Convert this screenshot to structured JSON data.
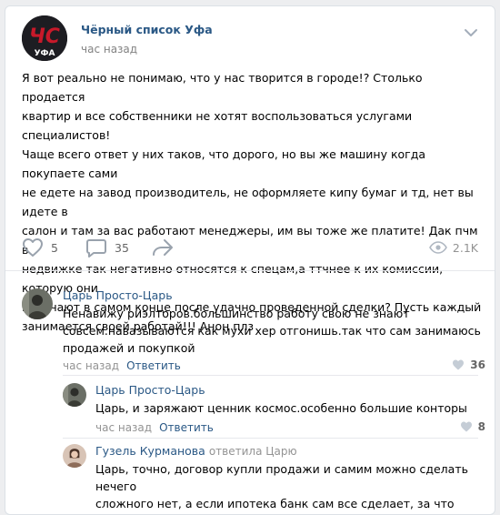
{
  "post": {
    "group_name": "Чёрный список Уфа",
    "time": "час назад",
    "logo_text_top": "ЧС",
    "logo_text_bottom": "УФА",
    "text": "Я вот реально не понимаю, что у нас творится в городе!? Столько продается\nквартир и все собственники не хотят воспользоваться услугами специалистов!\nЧаще всего ответ у них таков, что дорого, но вы же машину когда покупаете сами\nне едете на завод производитель, не оформляете кипу бумаг и тд, нет вы идете в\nсалон и там за вас работают менеджеры, им вы тоже же платите! Дак пчм в\nнедвижке так негативно относятся к спецам,а ттчнее к их комиссии, которую они\nполучают в самом конце после удачно проведенной сделки? Пусть каждый\nзанимается своей работай!!! Анон плз",
    "likes": "5",
    "comments": "35",
    "views": "2.1K"
  },
  "comments": [
    {
      "author": "Царь Просто-Царь",
      "text_lines": [
        "Ненавижу риэлторов.большинство работу свою не знают",
        "совсем.навазываются как мухи хер отгонишь.так что сам занимаюсь",
        "продажей и покупкой"
      ],
      "time": "час назад",
      "reply_label": "Ответить",
      "likes": "36"
    },
    {
      "author": "Царь Просто-Царь",
      "text_lines": [
        "Царь, и заряжают ценник космос.особенно большие конторы"
      ],
      "time": "час назад",
      "reply_label": "Ответить",
      "likes": "8"
    },
    {
      "author": "Гузель Курманова",
      "reply_to": "ответила Царю",
      "text_lines": [
        "Царь, точно, договор купли продажи и самим можно сделать нечего",
        "сложного нет, а если ипотека банк сам все сделает, за что такие"
      ]
    }
  ],
  "icons": {
    "menu": "chevron-down-icon",
    "like": "heart-icon",
    "comment": "comment-bubble-icon",
    "share": "share-arrow-icon",
    "views": "eye-icon"
  },
  "colors": {
    "link": "#2a5885",
    "muted": "#939393",
    "background": "#edeef0",
    "logo_red": "#c8192a"
  }
}
